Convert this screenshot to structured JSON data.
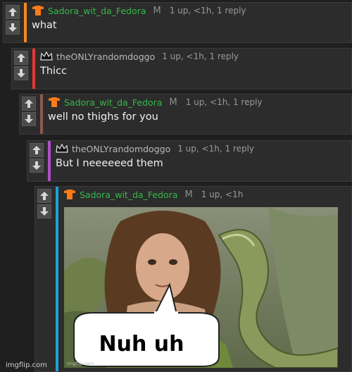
{
  "comments": [
    {
      "user": "Sadora_wit_da_Fedora",
      "flag": "M",
      "stats": "1 up, <1h, 1 reply",
      "text": "what",
      "bar_color": "#f58a1f",
      "hat": "orange-tshirt-icon"
    },
    {
      "user": "theONLYrandomdoggo",
      "flag": "",
      "stats": "1 up, <1h, 1 reply",
      "text": "Thicc",
      "bar_color": "#e53935",
      "hat": "crown-icon"
    },
    {
      "user": "Sadora_wit_da_Fedora",
      "flag": "M",
      "stats": "1 up, <1h, 1 reply",
      "text": "well no thighs for you",
      "bar_color": "#8b5a50",
      "hat": "orange-tshirt-icon"
    },
    {
      "user": "theONLYrandomdoggo",
      "flag": "",
      "stats": "1 up, <1h, 1 reply",
      "text": "But I neeeeeed them",
      "bar_color": "#b14fc5",
      "hat": "crown-icon"
    },
    {
      "user": "Sadora_wit_da_Fedora",
      "flag": "M",
      "stats": "1 up, <1h",
      "text": "",
      "bar_color": "#1fa2d8",
      "hat": "orange-tshirt-icon"
    }
  ],
  "meme": {
    "caption": "Nuh uh",
    "watermark": "imgflip.com"
  },
  "footer": {
    "text": "imgflip.com"
  }
}
